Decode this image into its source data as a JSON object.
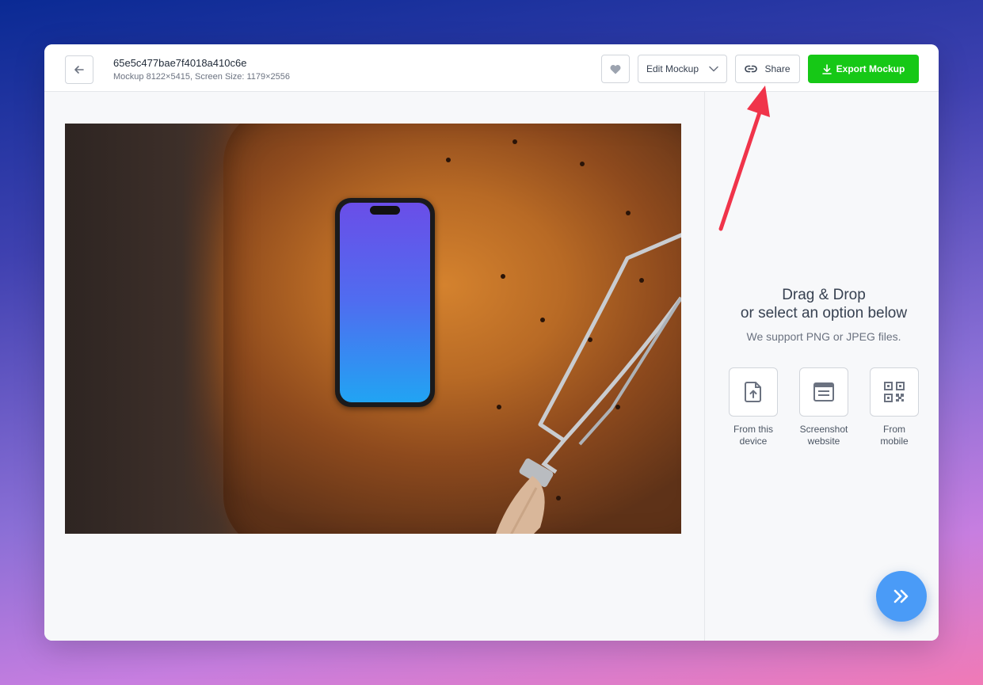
{
  "header": {
    "mockup_id": "65e5c477bae7f4018a410c6e",
    "mockup_meta": "Mockup 8122×5415, Screen Size: 1179×2556",
    "edit_label": "Edit Mockup",
    "share_label": "Share",
    "export_label": "Export Mockup"
  },
  "upload_panel": {
    "title_line1": "Drag & Drop",
    "title_line2": "or select an option below",
    "support_text": "We support PNG or JPEG files.",
    "options": [
      {
        "line1": "From this",
        "line2": "device",
        "icon": "upload-file-icon"
      },
      {
        "line1": "Screenshot",
        "line2": "website",
        "icon": "browser-window-icon"
      },
      {
        "line1": "From",
        "line2": "mobile",
        "icon": "qr-code-icon"
      }
    ]
  },
  "colors": {
    "export_green": "#16c816",
    "fab_blue": "#4a9bf7",
    "annotation_red": "#f0344a"
  }
}
